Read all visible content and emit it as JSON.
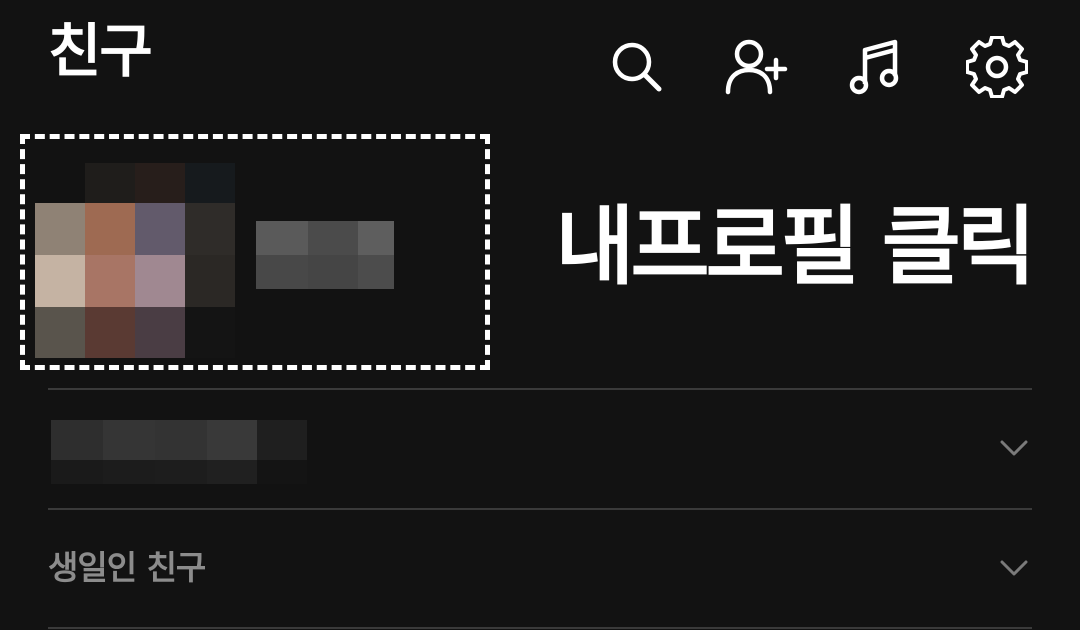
{
  "header": {
    "title": "친구",
    "icons": [
      "search-icon",
      "add-friend-icon",
      "music-icon",
      "settings-icon"
    ],
    "icon_color": "#ffffff"
  },
  "annotation": {
    "callout_text": "내프로필 클릭",
    "highlight_color": "#ffffff"
  },
  "profile": {
    "avatar": "pixelated-profile-photo",
    "name": "pixelated-name"
  },
  "sections": [
    {
      "label": "",
      "redacted": true,
      "icon": "chevron-down-icon"
    },
    {
      "label": "생일인 친구",
      "icon": "chevron-down-icon"
    }
  ],
  "colors": {
    "background": "#121212",
    "divider": "#3a3a3a",
    "section_label": "#8c8c8c",
    "chevron": "#7a7a7a"
  }
}
